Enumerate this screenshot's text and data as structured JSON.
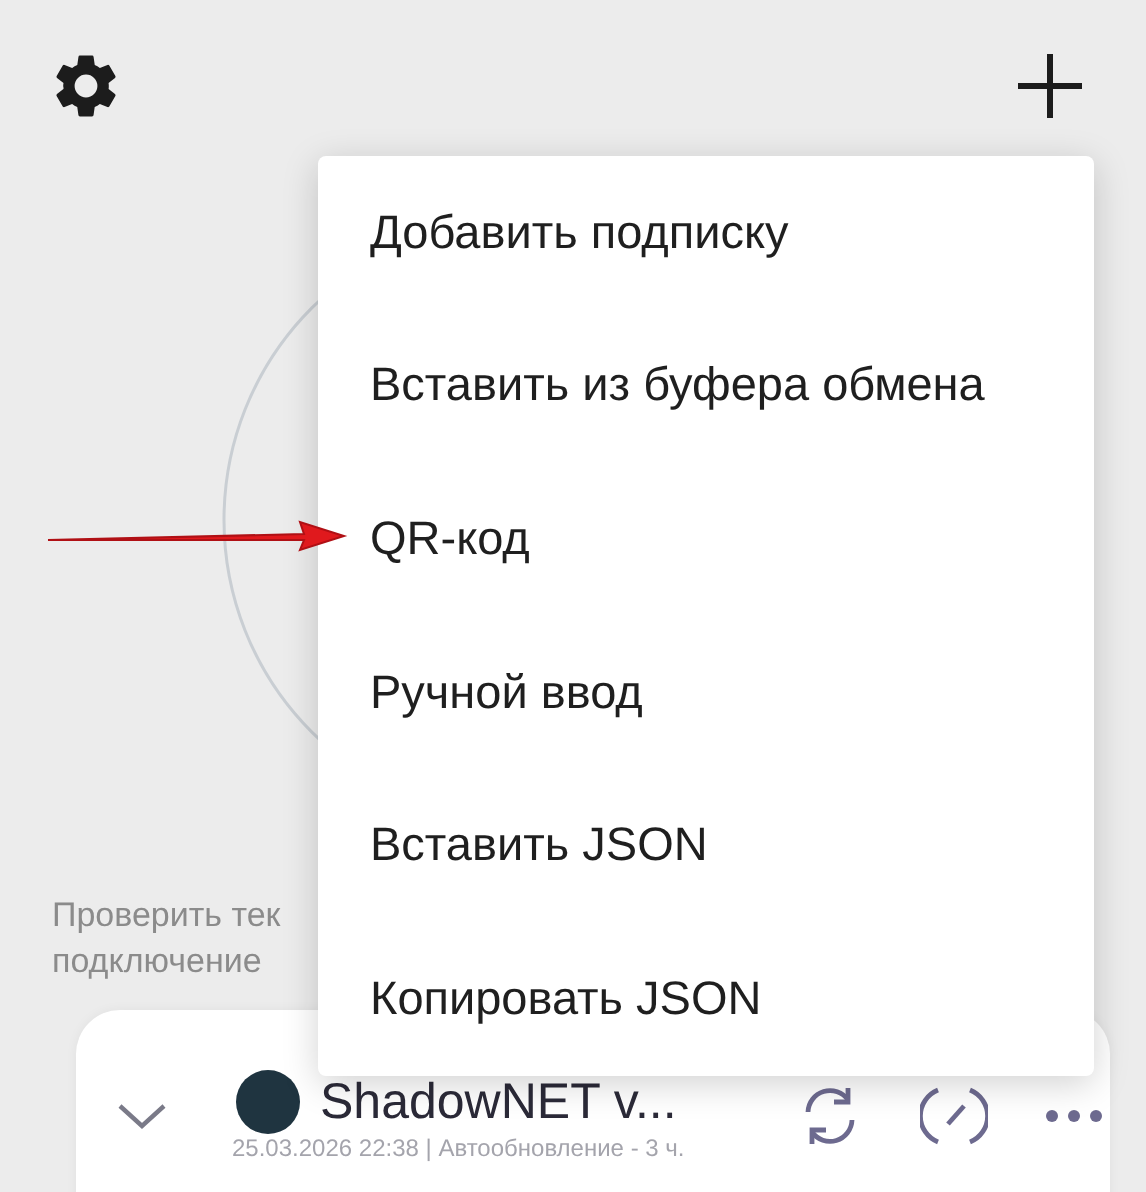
{
  "hint_lines": [
    "Проверить тек",
    "подключение"
  ],
  "profile": {
    "name": "ShadowNET v...",
    "meta": "25.03.2026 22:38 | Автообновление - 3 ч."
  },
  "menu": {
    "items": [
      {
        "label": "Добавить подписку"
      },
      {
        "label": "Вставить из буфера обмена"
      },
      {
        "label": "QR-код"
      },
      {
        "label": "Ручной ввод"
      },
      {
        "label": "Вставить JSON"
      },
      {
        "label": "Копировать JSON"
      }
    ]
  }
}
